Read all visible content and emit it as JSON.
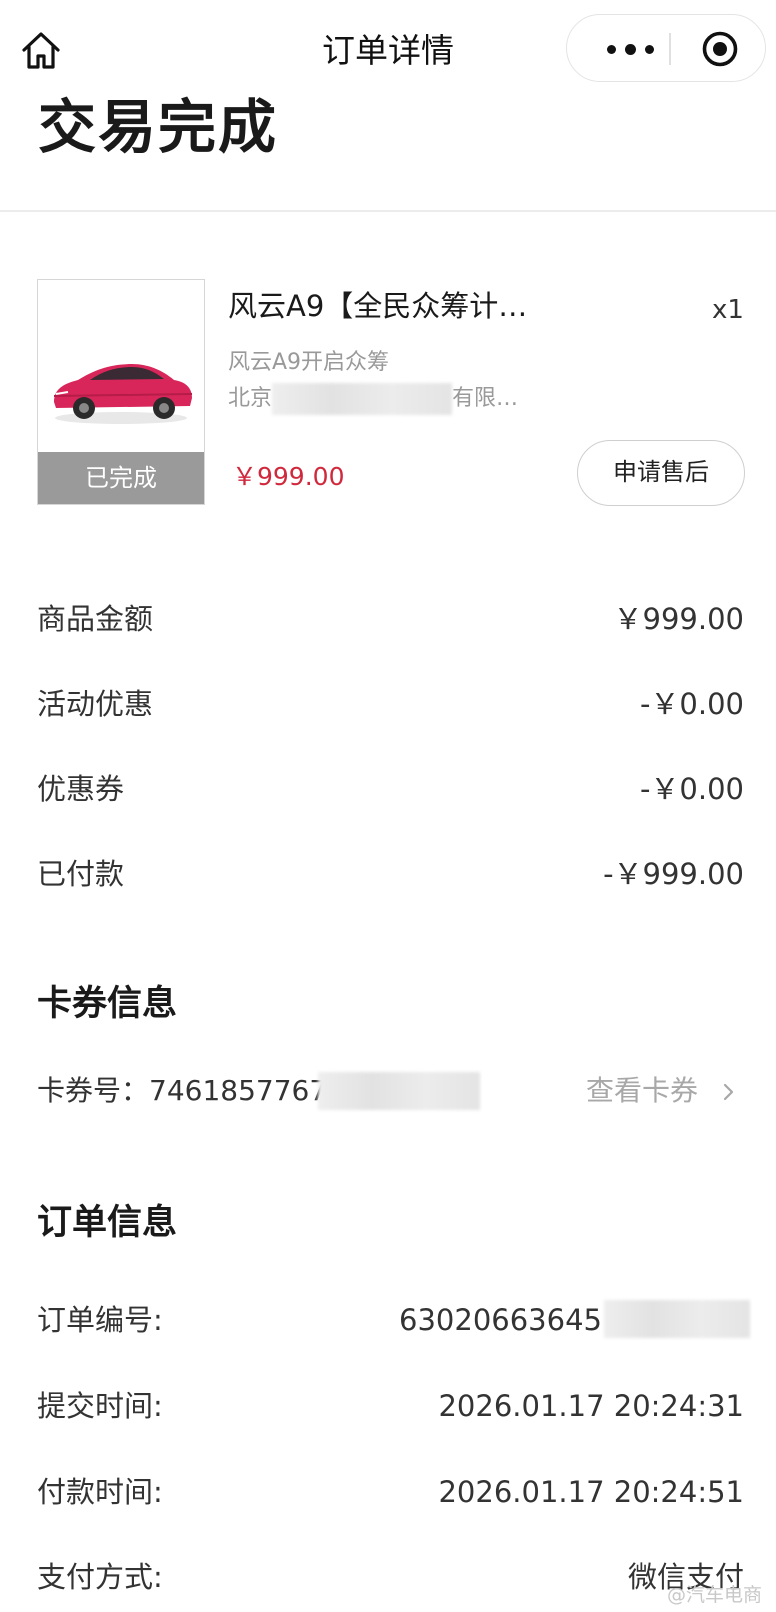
{
  "nav": {
    "title": "订单详情",
    "icons": [
      "home-icon",
      "more-dots-icon",
      "target-icon"
    ]
  },
  "status": {
    "title": "交易完成"
  },
  "product": {
    "name": "风云A9【全民众筹计…",
    "quantity": "x1",
    "subtitle": "风云A9开启众筹",
    "shop_prefix": "北京",
    "shop_suffix": "有限…",
    "status_badge": "已完成",
    "price": "￥999.00",
    "aftersale_button": "申请售后",
    "car_color": "#d9265a"
  },
  "amounts": [
    {
      "label": "商品金额",
      "value": "￥999.00"
    },
    {
      "label": "活动优惠",
      "value": "-￥0.00"
    },
    {
      "label": "优惠券",
      "value": "-￥0.00"
    },
    {
      "label": "已付款",
      "value": "-￥999.00"
    }
  ],
  "coupon": {
    "section_title": "卡券信息",
    "number_text": "卡券号：7461857767",
    "view_link": "查看卡券"
  },
  "order": {
    "section_title": "订单信息",
    "rows": [
      {
        "label": "订单编号:",
        "value": "63020663645"
      },
      {
        "label": "提交时间:",
        "value": "2026.01.17 20:24:31"
      },
      {
        "label": "付款时间:",
        "value": "2026.01.17 20:24:51"
      },
      {
        "label": "支付方式:",
        "value": "微信支付"
      }
    ]
  },
  "watermark": "@汽车电商"
}
